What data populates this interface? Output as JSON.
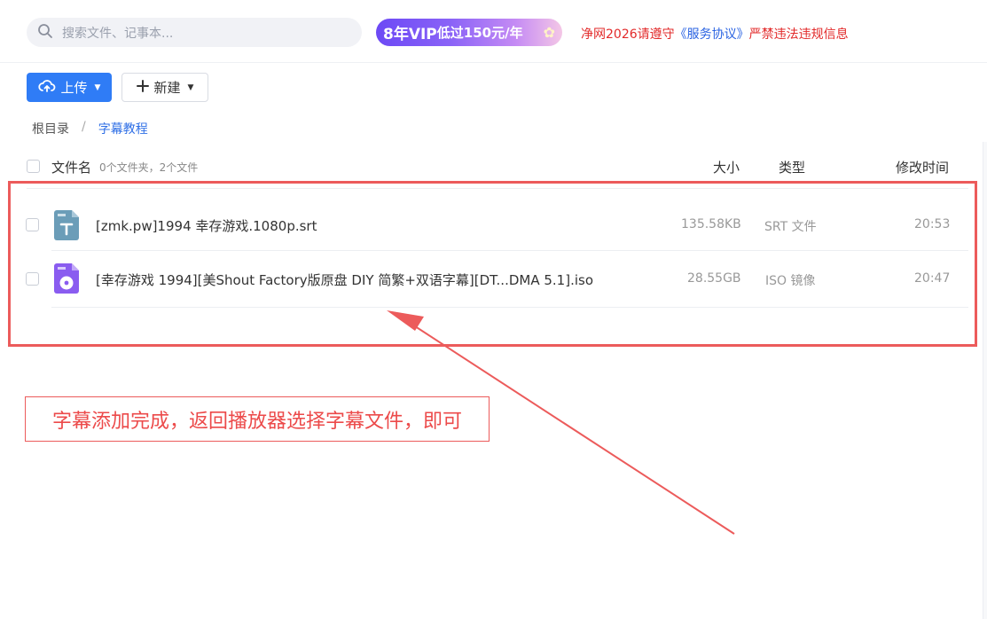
{
  "search": {
    "placeholder": "搜索文件、记事本..."
  },
  "vip_banner": {
    "text_strong": "8年VIP",
    "text_rest": " 低过150元/年"
  },
  "notice": {
    "prefix": "净网2026请遵守",
    "link": "《服务协议》",
    "suffix": "严禁违法违规信息"
  },
  "toolbar": {
    "upload_label": "上传",
    "new_label": "新建"
  },
  "breadcrumb": {
    "root": "根目录",
    "separator": "/",
    "current": "字幕教程"
  },
  "table": {
    "headers": {
      "name": "文件名",
      "count": "0个文件夹，2个文件",
      "size": "大小",
      "type": "类型",
      "mtime": "修改时间"
    },
    "rows": [
      {
        "name": "[zmk.pw]1994 幸存游戏.1080p.srt",
        "size": "135.58KB",
        "type": "SRT 文件",
        "mtime": "20:53",
        "icon": "subtitle-file-icon"
      },
      {
        "name": "[幸存游戏 1994][美Shout Factory版原盘 DIY 简繁+双语字幕][DT...DMA 5.1].iso",
        "size": "28.55GB",
        "type": "ISO 镜像",
        "mtime": "20:47",
        "icon": "disc-image-file-icon"
      }
    ]
  },
  "annotation": {
    "note": "字幕添加完成，返回播放器选择字幕文件，即可"
  },
  "colors": {
    "accent": "#2f7cf6",
    "annotation": "#ec5b5b",
    "notice": "#e22a2a"
  }
}
